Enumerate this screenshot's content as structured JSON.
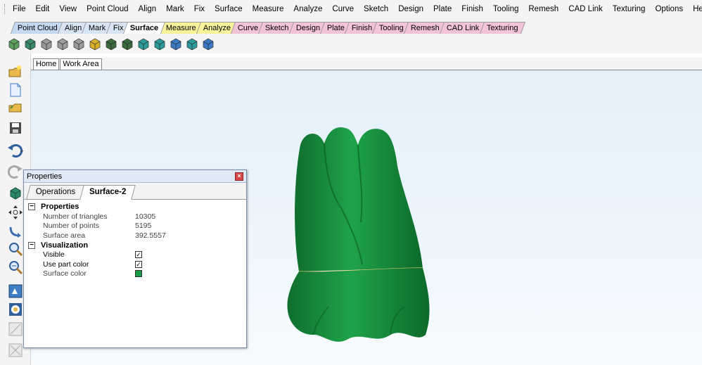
{
  "menu": [
    "File",
    "Edit",
    "View",
    "Point Cloud",
    "Align",
    "Mark",
    "Fix",
    "Surface",
    "Measure",
    "Analyze",
    "Curve",
    "Sketch",
    "Design",
    "Plate",
    "Finish",
    "Tooling",
    "Remesh",
    "CAD Link",
    "Texturing",
    "Options",
    "Help"
  ],
  "ribbon_tabs": [
    {
      "label": "Point Cloud",
      "color": "#c4d9f1"
    },
    {
      "label": "Align",
      "color": "#d8e5f5"
    },
    {
      "label": "Mark",
      "color": "#d8e5f5"
    },
    {
      "label": "Fix",
      "color": "#d8e5f5"
    },
    {
      "label": "Surface",
      "color": "#ffffff",
      "active": true
    },
    {
      "label": "Measure",
      "color": "#f9f39a"
    },
    {
      "label": "Analyze",
      "color": "#f9f39a"
    },
    {
      "label": "Curve",
      "color": "#f3c4d8"
    },
    {
      "label": "Sketch",
      "color": "#f3c4d8"
    },
    {
      "label": "Design",
      "color": "#f3c4d8"
    },
    {
      "label": "Plate",
      "color": "#f3c4d8"
    },
    {
      "label": "Finish",
      "color": "#f3c4d8"
    },
    {
      "label": "Tooling",
      "color": "#f3c4d8"
    },
    {
      "label": "Remesh",
      "color": "#f3c4d8"
    },
    {
      "label": "CAD Link",
      "color": "#f3c4d8"
    },
    {
      "label": "Texturing",
      "color": "#f3c4d8"
    }
  ],
  "toolbar_icons": [
    "surface-arrow-icon",
    "surface-box-icon",
    "surface-gray-icon",
    "surface-gray2-icon",
    "surface-gray3-icon",
    "surface-yellow-icon",
    "surface-mesh-icon",
    "surface-grid-icon",
    "surface-fit-icon",
    "surface-fit2-icon",
    "surface-fit3-icon",
    "surface-fit4-icon",
    "surface-sphere-icon"
  ],
  "left_toolbar_icons": [
    "open-folder-icon",
    "new-file-icon",
    "open-file-icon",
    "save-icon",
    "undo-icon",
    "redo-icon",
    "cube-view-icon",
    "pan-icon",
    "rotate-icon",
    "zoom-icon",
    "zoom-box-icon",
    "fit-view-icon",
    "display-icon",
    "picture-icon",
    "picture2-icon"
  ],
  "doc_tabs": [
    {
      "label": "Home"
    },
    {
      "label": "Work Area",
      "active": true
    }
  ],
  "properties_panel": {
    "title": "Properties",
    "tabs": [
      "Operations",
      "Surface-2"
    ],
    "active_tab": "Surface-2",
    "sections": [
      {
        "name": "Properties",
        "rows": [
          {
            "label": "Number of triangles",
            "value": "10305"
          },
          {
            "label": "Number of points",
            "value": "5195"
          },
          {
            "label": "Surface area",
            "value": "392.5557"
          }
        ]
      },
      {
        "name": "Visualization",
        "rows": [
          {
            "label": "Visible",
            "checked": true
          },
          {
            "label": "Use part color",
            "checked": true
          },
          {
            "label": "Surface color",
            "color": "#1a9a45"
          }
        ]
      }
    ]
  },
  "model": {
    "color": "#1a9a45"
  }
}
